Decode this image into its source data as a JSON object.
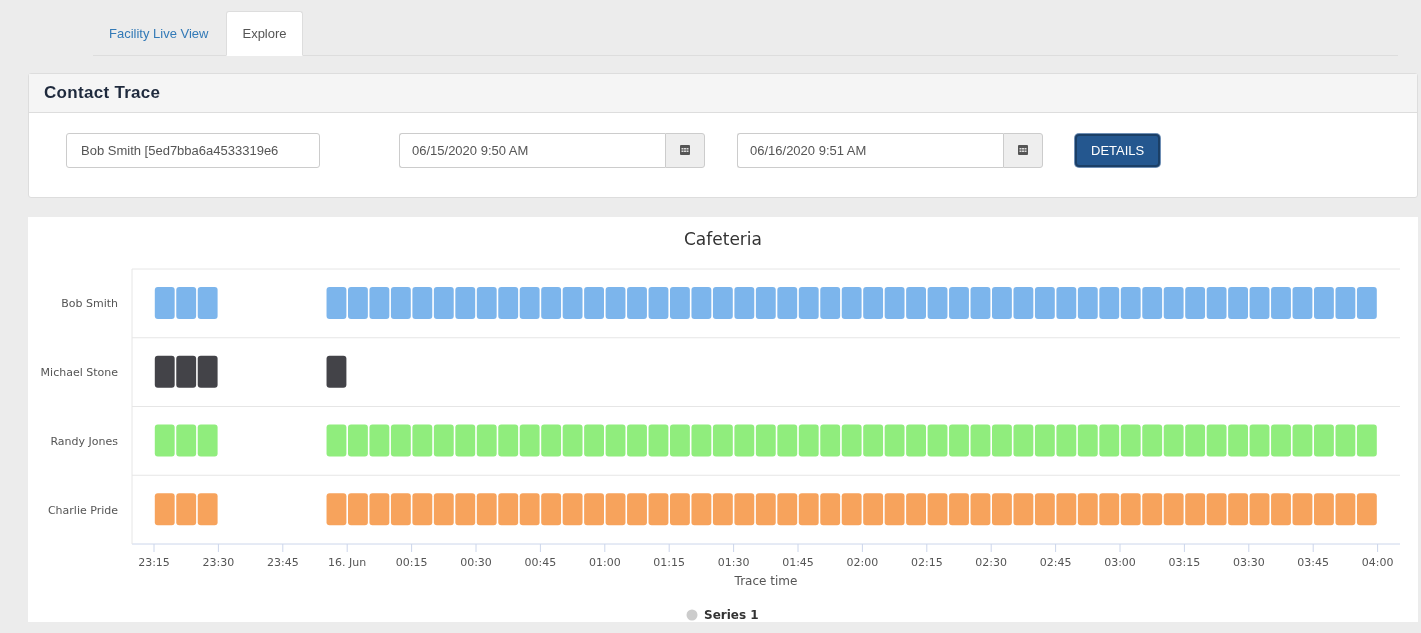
{
  "tabs": [
    {
      "label": "Facility Live View",
      "selected": false
    },
    {
      "label": "Explore",
      "selected": true
    }
  ],
  "panel": {
    "title": "Contact Trace",
    "person_field": {
      "value": "Bob Smith [5ed7bba6a4533319e6"
    },
    "start_field": {
      "value": "06/15/2020 9:50 AM"
    },
    "end_field": {
      "value": "06/16/2020 9:51 AM"
    },
    "details_button": "DETAILS"
  },
  "timeline": {
    "title": "Cafeteria",
    "axis_title": "Trace time",
    "axis_labels": [
      "23:15",
      "23:30",
      "23:45",
      "16. Jun",
      "00:15",
      "00:30",
      "00:45",
      "01:00",
      "01:15",
      "01:30",
      "01:45",
      "02:00",
      "02:15",
      "02:30",
      "02:45",
      "03:00",
      "03:15",
      "03:30",
      "03:45",
      "04:00"
    ],
    "legend": {
      "name": "Series 1",
      "color": "#cccccc"
    },
    "rows": [
      {
        "name": "Bob Smith",
        "color": "#7cb5ec"
      },
      {
        "name": "Michael Stone",
        "color": "#434348"
      },
      {
        "name": "Randy Jones",
        "color": "#90ed7d"
      },
      {
        "name": "Charlie Pride",
        "color": "#f7a35c"
      }
    ]
  }
}
